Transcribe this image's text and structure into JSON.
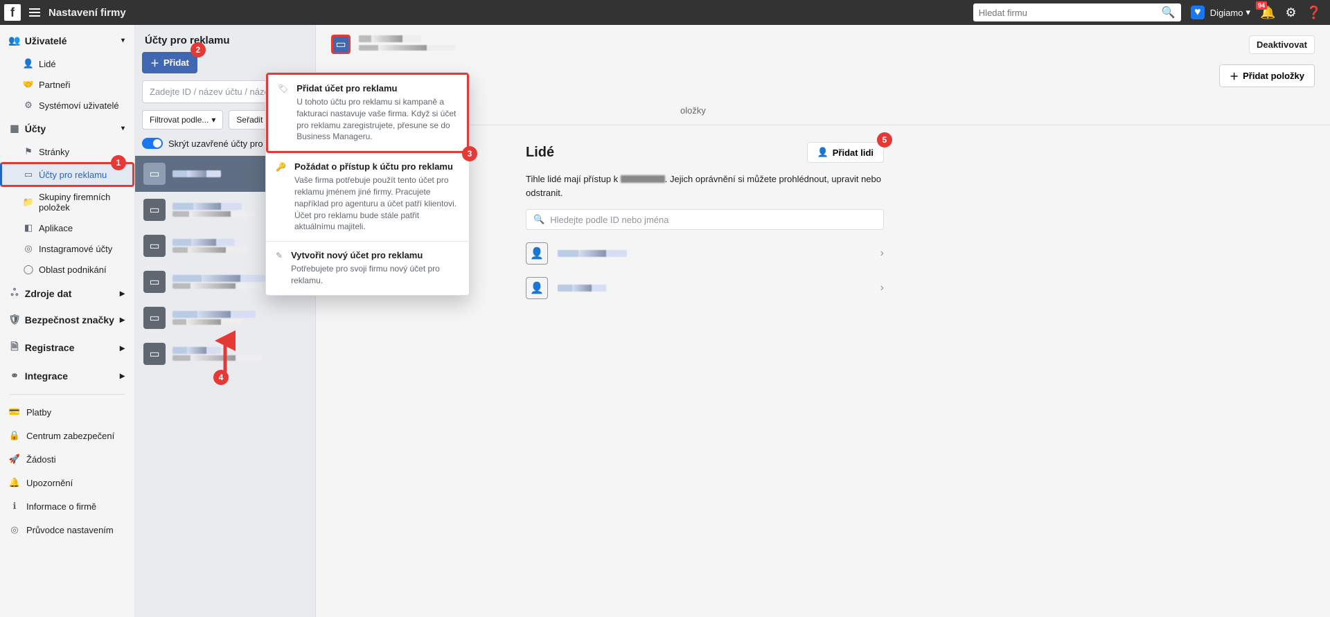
{
  "topbar": {
    "title": "Nastavení firmy",
    "search_placeholder": "Hledat firmu",
    "account": "Digiamo",
    "badge": "94"
  },
  "side": {
    "section1": {
      "title": "Uživatelé",
      "items": [
        "Lidé",
        "Partneři",
        "Systémoví uživatelé"
      ]
    },
    "section2": {
      "title": "Účty",
      "items": [
        "Stránky",
        "Účty pro reklamu",
        "Skupiny firemních položek",
        "Aplikace",
        "Instagramové účty",
        "Oblast podnikání"
      ]
    },
    "collapsed": [
      "Zdroje dat",
      "Bezpečnost značky",
      "Registrace",
      "Integrace"
    ],
    "bottom": [
      "Platby",
      "Centrum zabezpečení",
      "Žádosti",
      "Upozornění",
      "Informace o firmě",
      "Průvodce nastavením"
    ]
  },
  "mid": {
    "title": "Účty pro reklamu",
    "add_btn": "Přidat",
    "search_placeholder": "Zadejte ID / název účtu / název firmy",
    "filter": "Filtrovat podle...",
    "sort": "Seřadit podle...",
    "toggle": "Skrýt uzavřené účty pro reklamu"
  },
  "dropdown": {
    "items": [
      {
        "title": "Přidat účet pro reklamu",
        "desc": "U tohoto účtu pro reklamu si kampaně a fakturaci nastavuje vaše firma. Když si účet pro reklamu zaregistrujete, přesune se do Business Manageru."
      },
      {
        "title": "Požádat o přístup k účtu pro reklamu",
        "desc": "Vaše firma potřebuje použít tento účet pro reklamu jménem jiné firmy. Pracujete například pro agenturu a účet patří klientovi. Účet pro reklamu bude stále patřit aktuálnímu majiteli."
      },
      {
        "title": "Vytvořit nový účet pro reklamu",
        "desc": "Potřebujete pro svoji firmu nový účet pro reklamu."
      }
    ]
  },
  "main": {
    "deactivate": "Deaktivovat",
    "add_items": "Přidat položky",
    "tab_partial": "oložky",
    "people_title": "Lidé",
    "add_people": "Přidat lidi",
    "desc_prefix": "Tihle lidé mají přístup k ",
    "desc_suffix": ". Jejich oprávnění si můžete prohlédnout, upravit nebo odstranit.",
    "people_search_placeholder": "Hledejte podle ID nebo jména"
  },
  "annotations": [
    "1",
    "2",
    "3",
    "4",
    "5"
  ]
}
